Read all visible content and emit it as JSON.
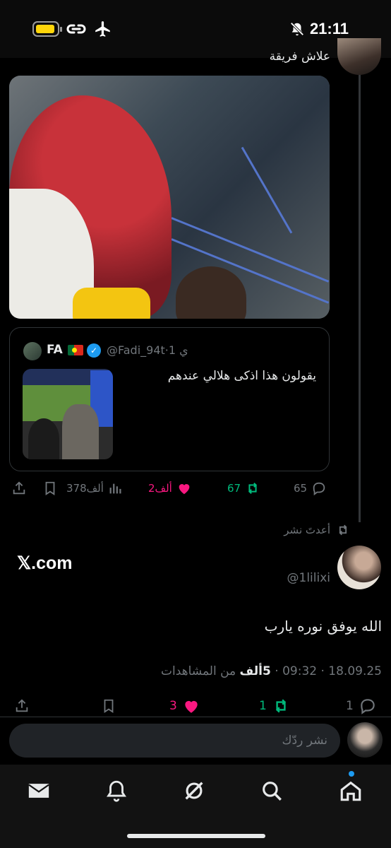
{
  "status_bar": {
    "time": "21:11"
  },
  "top_tweet": {
    "text": "علاش فريقة"
  },
  "quote_tweet": {
    "name": "FA",
    "handle": "@Fadi_94t",
    "time": "1 ي",
    "text": "يقولون هذا اذكى هلالي عندهم"
  },
  "top_actions": {
    "replies": "65",
    "reposts": "67",
    "likes": "2ألف",
    "views": "378ألف"
  },
  "reposted_label": "أعدتَ نشر",
  "main_tweet": {
    "source": "𝕏.com",
    "handle": "@1lilixi",
    "text": "الله يوفق نوره يارب",
    "date": "18.09.25",
    "clock": "09:32",
    "views_count": "5ألف",
    "views_label": "من المشاهدات",
    "replies": "1",
    "reposts": "1",
    "likes": "3"
  },
  "reply_bar": {
    "placeholder": "نشر ردّك"
  },
  "colors": {
    "like": "#f91880",
    "repost": "#00ba7c",
    "accent": "#1d9bf0"
  },
  "icons": [
    "reply-icon",
    "repost-icon",
    "like-icon",
    "views-icon",
    "bookmark-icon",
    "share-icon",
    "mail-icon",
    "bell-icon",
    "grok-icon",
    "search-icon",
    "home-icon"
  ]
}
